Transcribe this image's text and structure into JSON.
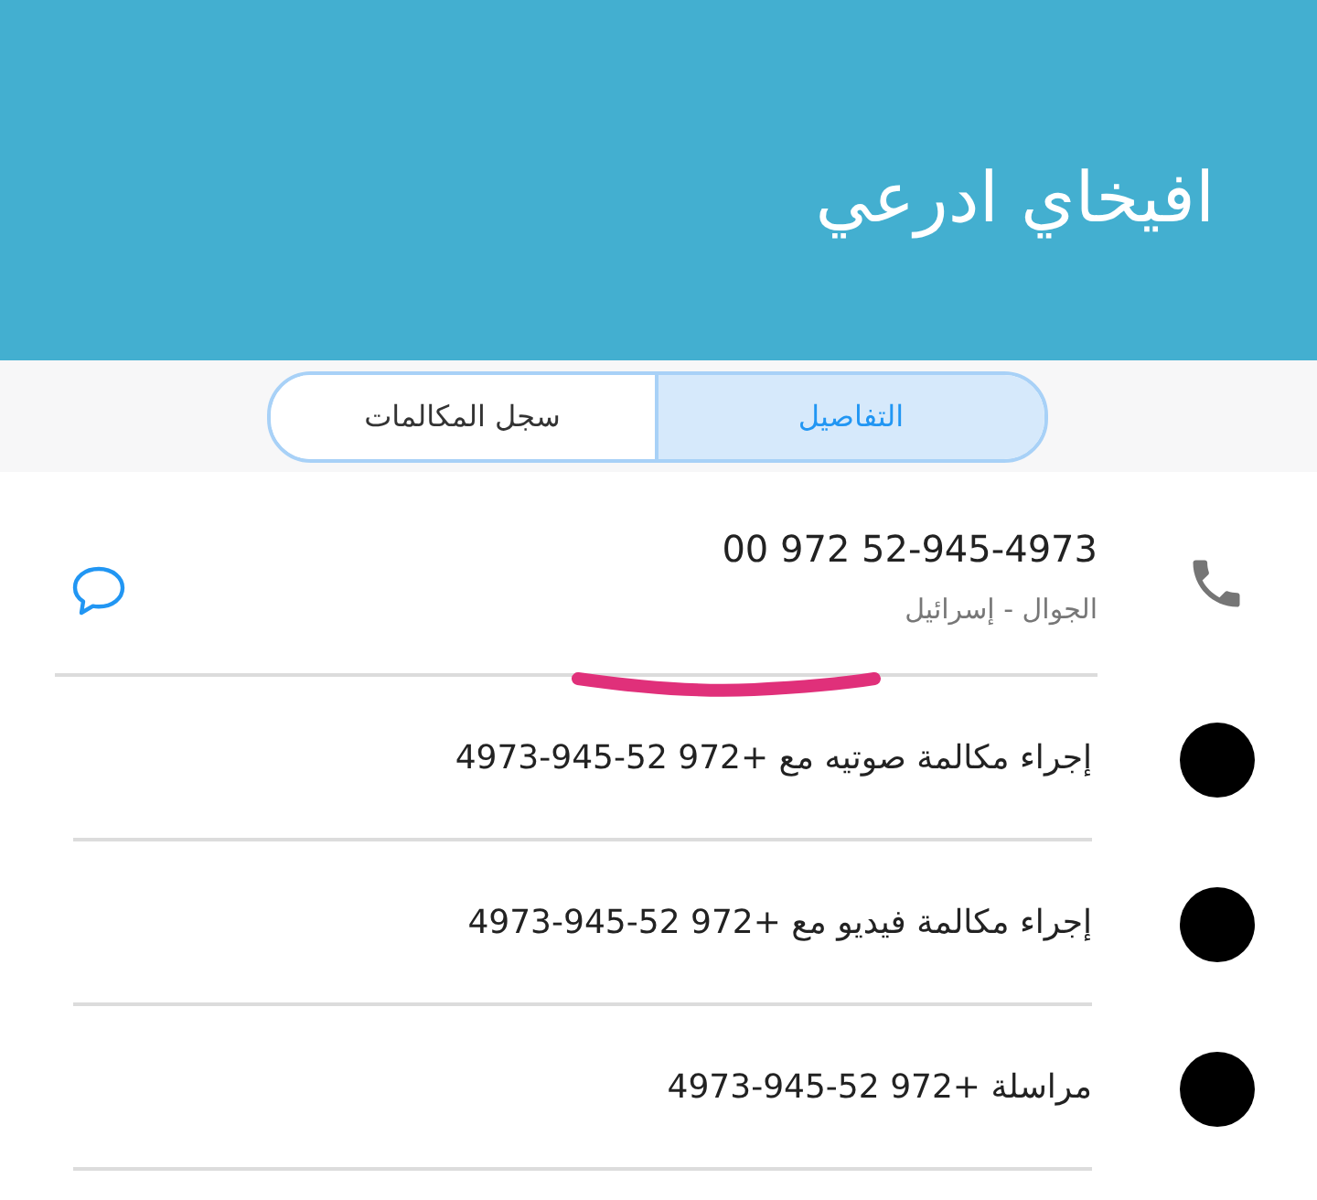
{
  "header": {
    "title": "افيخاي ادرعي"
  },
  "tabs": [
    {
      "label": "التفاصيل",
      "selected": true
    },
    {
      "label": "سجل المكالمات",
      "selected": false
    }
  ],
  "contact": {
    "number": "00 972 52-945-4973",
    "subtitle": "الجوال - إسرائيل"
  },
  "actions": [
    {
      "label": "إجراء مكالمة صوتيه مع +972 52-945-4973"
    },
    {
      "label": "إجراء مكالمة فيديو مع +972 52-945-4973"
    },
    {
      "label": "مراسلة +972 52-945-4973"
    }
  ]
}
